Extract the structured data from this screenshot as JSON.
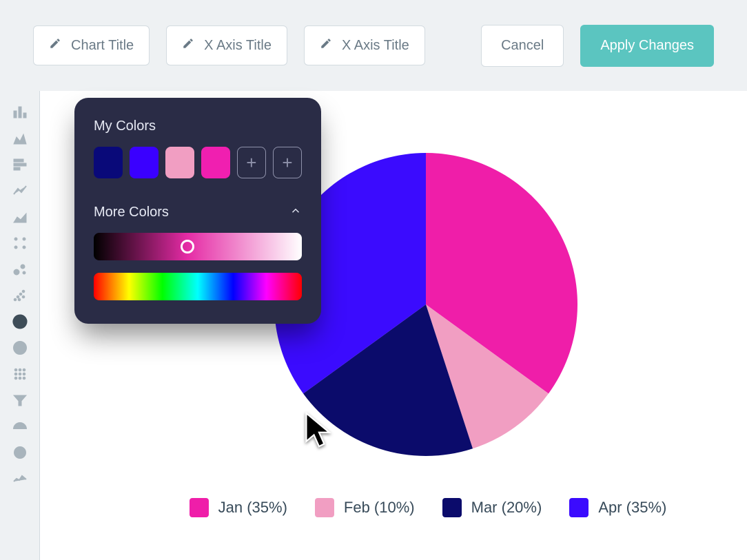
{
  "toolbar": {
    "edit_fields": [
      {
        "label": "Chart Title"
      },
      {
        "label": "X Axis Title"
      },
      {
        "label": "X Axis Title"
      }
    ],
    "cancel": "Cancel",
    "apply": "Apply Changes"
  },
  "sidebar_icons": [
    "bar-chart-icon",
    "area-chart-icon",
    "horizontal-bar-icon",
    "line-chart-icon",
    "stacked-area-icon",
    "scatter-4-icon",
    "bubble-icon",
    "scatter-many-icon",
    "pie-chart-icon",
    "donut-chart-icon",
    "grid-icon",
    "funnel-icon",
    "gauge-icon",
    "ring-icon",
    "sparkline-icon"
  ],
  "color_picker": {
    "my_colors_label": "My Colors",
    "swatches": [
      "#090979",
      "#3A00FF",
      "#F19EC2",
      "#F01FB0"
    ],
    "more_colors_label": "More Colors"
  },
  "chart_data": {
    "type": "pie",
    "series": [
      {
        "name": "Jan",
        "value": 35,
        "color": "#EF1EA9"
      },
      {
        "name": "Feb",
        "value": 10,
        "color": "#F19EC2"
      },
      {
        "name": "Mar",
        "value": 20,
        "color": "#0B0B6B"
      },
      {
        "name": "Apr",
        "value": 35,
        "color": "#3B0BFE"
      }
    ],
    "legend_format": "{name} ({pct}%)"
  }
}
